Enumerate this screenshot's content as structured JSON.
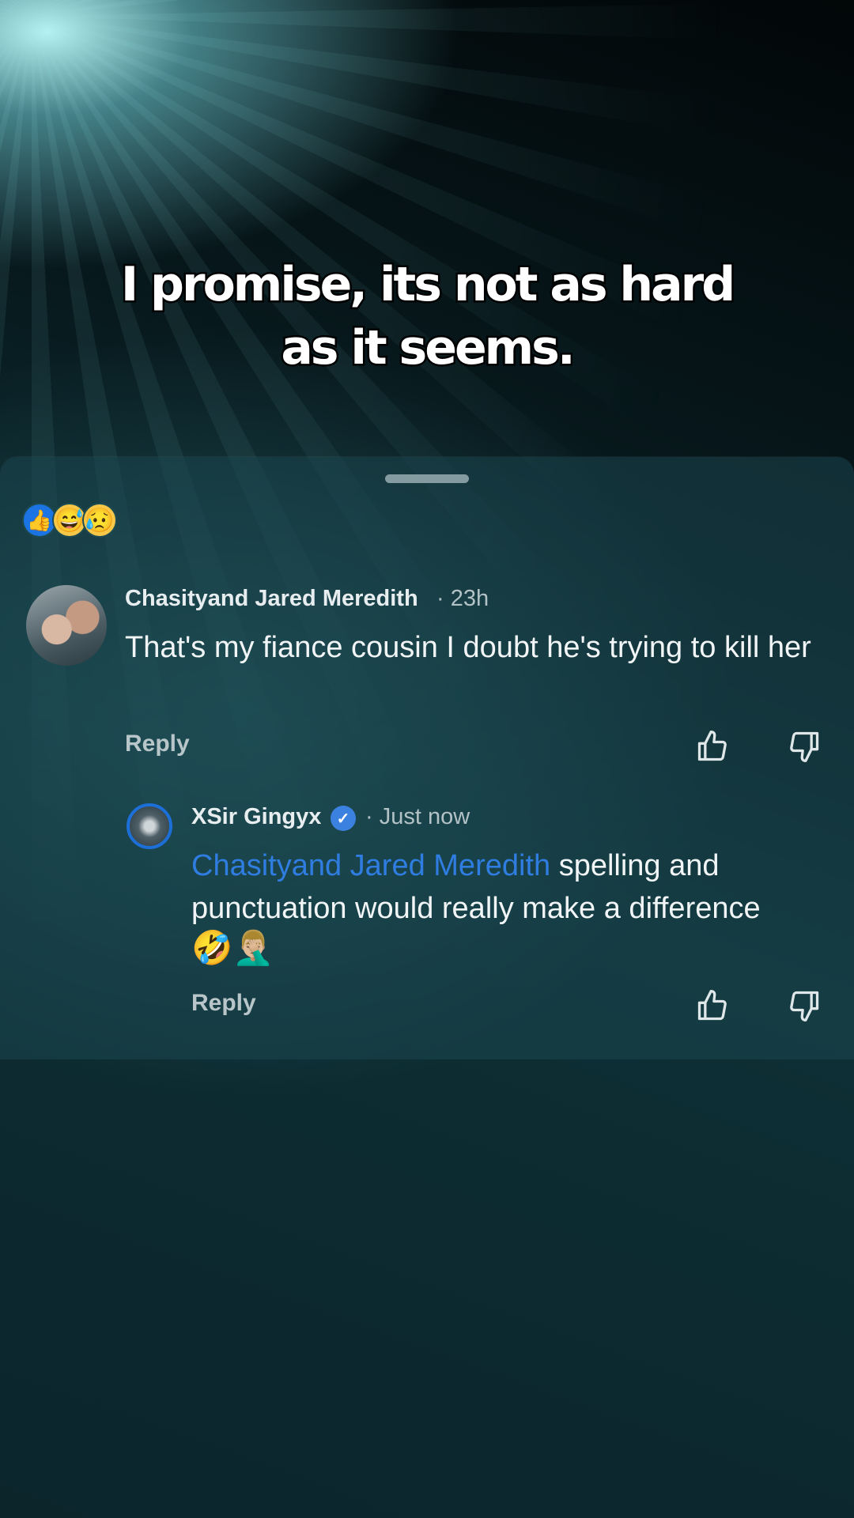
{
  "caption": {
    "line1": "I promise, its not as hard",
    "line2": "as it seems."
  },
  "reactions": [
    "like-icon",
    "haha-icon",
    "sad-icon"
  ],
  "comment": {
    "author": "Chasityand Jared Meredith",
    "time": "· 23h",
    "text": "That's my fiance cousin I doubt he's trying to kill her",
    "reply_label": "Reply"
  },
  "reply": {
    "author": "XSir Gingyx",
    "time": "· Just now",
    "mention": "Chasityand Jared Meredith",
    "text": " spelling and punctuation would really make a difference",
    "emojis": "🤣🤦🏼‍♂️",
    "reply_label": "Reply"
  },
  "colors": {
    "mention": "#2f7de0",
    "verified": "#3b82e0",
    "like": "#1b74e4"
  }
}
